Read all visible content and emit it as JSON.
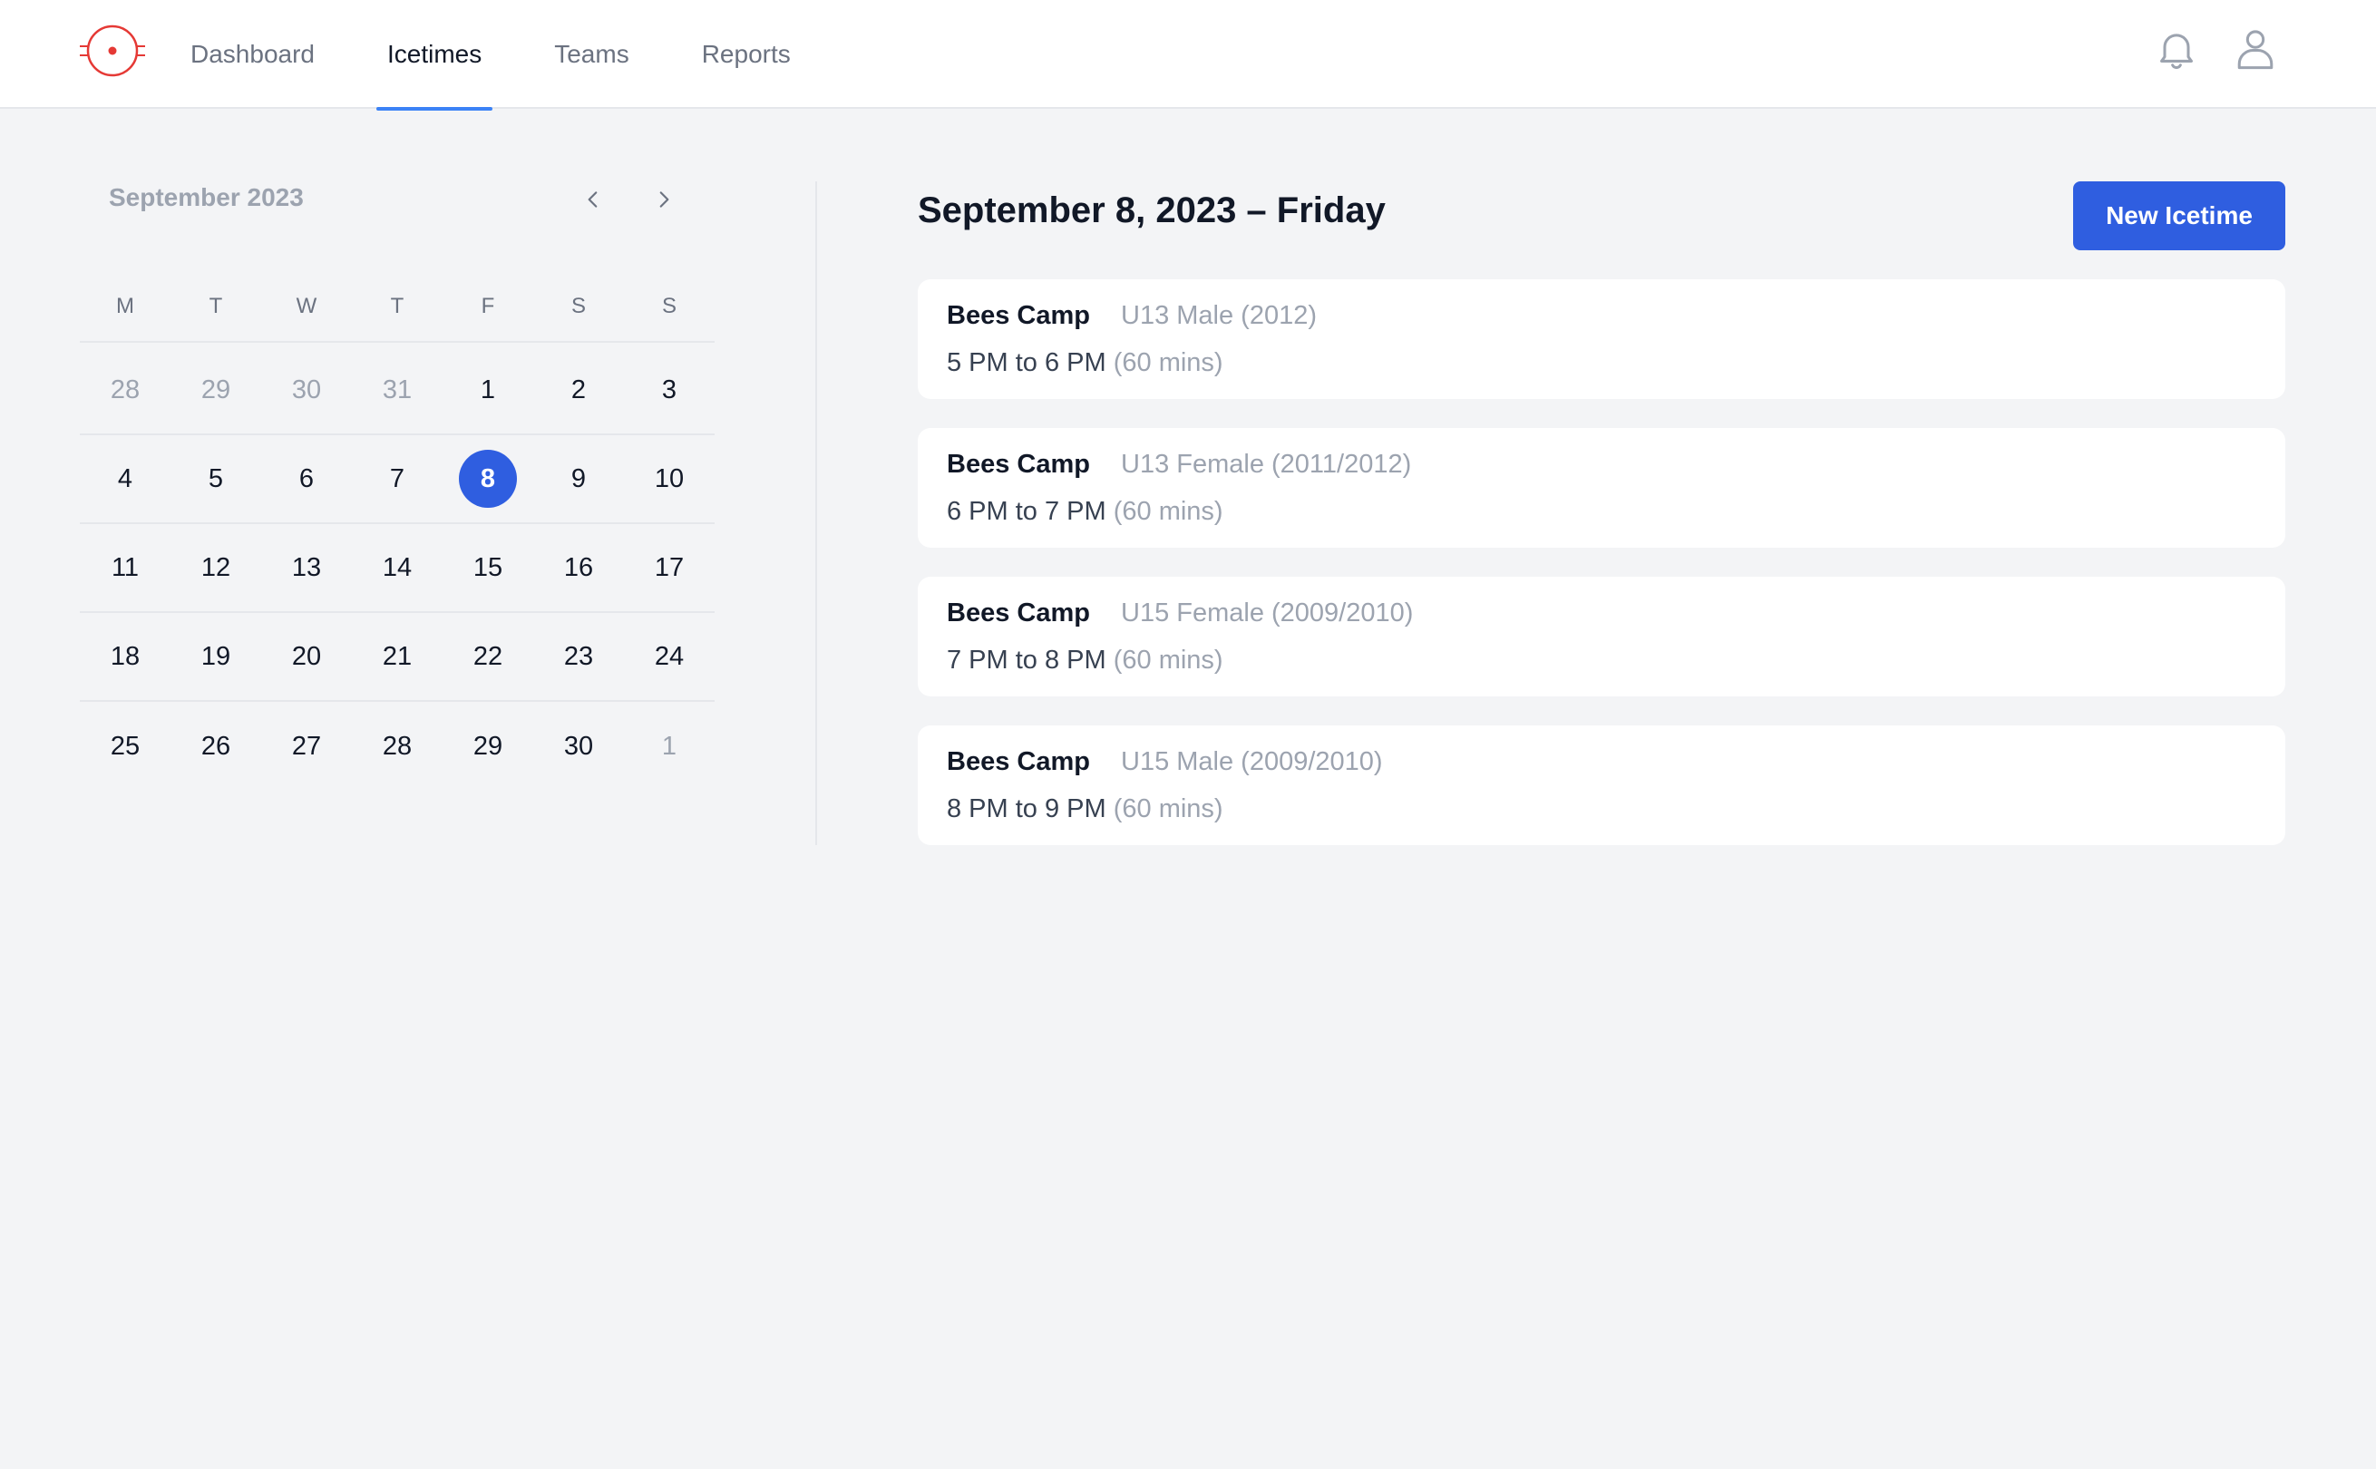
{
  "nav": {
    "items": [
      {
        "label": "Dashboard"
      },
      {
        "label": "Icetimes"
      },
      {
        "label": "Teams"
      },
      {
        "label": "Reports"
      }
    ],
    "active": "Icetimes"
  },
  "calendar": {
    "month_label": "September 2023",
    "weekdays": [
      "M",
      "T",
      "W",
      "T",
      "F",
      "S",
      "S"
    ],
    "weeks": [
      [
        {
          "d": "28",
          "muted": true
        },
        {
          "d": "29",
          "muted": true
        },
        {
          "d": "30",
          "muted": true
        },
        {
          "d": "31",
          "muted": true
        },
        {
          "d": "1"
        },
        {
          "d": "2"
        },
        {
          "d": "3"
        }
      ],
      [
        {
          "d": "4"
        },
        {
          "d": "5"
        },
        {
          "d": "6"
        },
        {
          "d": "7"
        },
        {
          "d": "8",
          "selected": true
        },
        {
          "d": "9"
        },
        {
          "d": "10"
        }
      ],
      [
        {
          "d": "11"
        },
        {
          "d": "12"
        },
        {
          "d": "13"
        },
        {
          "d": "14"
        },
        {
          "d": "15"
        },
        {
          "d": "16"
        },
        {
          "d": "17"
        }
      ],
      [
        {
          "d": "18"
        },
        {
          "d": "19"
        },
        {
          "d": "20"
        },
        {
          "d": "21"
        },
        {
          "d": "22"
        },
        {
          "d": "23"
        },
        {
          "d": "24"
        }
      ],
      [
        {
          "d": "25"
        },
        {
          "d": "26"
        },
        {
          "d": "27"
        },
        {
          "d": "28"
        },
        {
          "d": "29"
        },
        {
          "d": "30"
        },
        {
          "d": "1",
          "muted": true
        }
      ]
    ]
  },
  "main": {
    "title": "September 8, 2023 – Friday",
    "new_button_label": "New Icetime",
    "events": [
      {
        "name": "Bees Camp",
        "team": "U13 Male (2012)",
        "time": "5 PM to 6 PM",
        "duration": "(60 mins)"
      },
      {
        "name": "Bees Camp",
        "team": "U13 Female (2011/2012)",
        "time": "6 PM to 7 PM",
        "duration": "(60 mins)"
      },
      {
        "name": "Bees Camp",
        "team": "U15 Female (2009/2010)",
        "time": "7 PM to 8 PM",
        "duration": "(60 mins)"
      },
      {
        "name": "Bees Camp",
        "team": "U15 Male (2009/2010)",
        "time": "8 PM to 9 PM",
        "duration": "(60 mins)"
      }
    ]
  },
  "colors": {
    "accent": "#2f5ee0",
    "nav_underline": "#3b82f6",
    "logo": "#e53935",
    "background": "#f3f4f6"
  },
  "icons": {
    "logo": "target-logo-icon",
    "notifications": "bell-icon",
    "account": "user-icon",
    "prev": "chevron-left-icon",
    "next": "chevron-right-icon"
  }
}
